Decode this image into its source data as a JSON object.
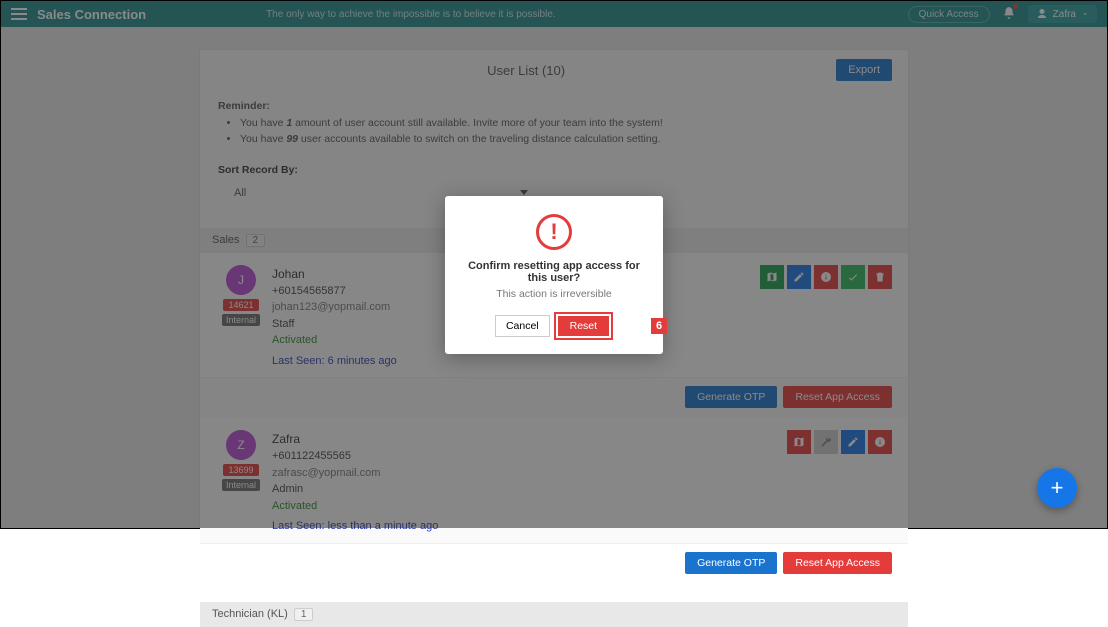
{
  "topbar": {
    "brand": "Sales Connection",
    "tagline": "The only way to achieve the impossible is to believe it is possible.",
    "quick_access": "Quick Access",
    "user_name": "Zafra"
  },
  "panel": {
    "title": "User List (10)",
    "export": "Export"
  },
  "reminder": {
    "title": "Reminder:",
    "l1a": "You have ",
    "l1b": "1",
    "l1c": " amount of user account still available. Invite more of your team into the system!",
    "l2a": "You have ",
    "l2b": "99",
    "l2c": " user accounts available to switch on the traveling distance calculation setting."
  },
  "sort": {
    "label": "Sort Record By:",
    "value": "All"
  },
  "groups": {
    "sales": {
      "name": "Sales",
      "count": "2"
    },
    "tech": {
      "name": "Technician (KL)",
      "count": "1"
    }
  },
  "users": [
    {
      "initial": "J",
      "avatar_color": "#b84ad6",
      "name": "Johan",
      "phone": "+60154565877",
      "email": "johan123@yopmail.com",
      "role": "Staff",
      "id": "14621",
      "internal": "Internal",
      "status": "Activated",
      "lastseen": "Last Seen: 6 minutes ago"
    },
    {
      "initial": "Z",
      "avatar_color": "#b84ad6",
      "name": "Zafra",
      "phone": "+601122455565",
      "email": "zafrasc@yopmail.com",
      "role": "Admin",
      "id": "13699",
      "internal": "Internal",
      "status": "Activated",
      "lastseen": "Last Seen: less than a minute ago"
    }
  ],
  "buttons": {
    "generate_otp": "Generate OTP",
    "reset_app": "Reset App Access"
  },
  "modal": {
    "title": "Confirm resetting app access for this user?",
    "sub": "This action is irreversible",
    "cancel": "Cancel",
    "reset": "Reset",
    "callout": "6"
  }
}
